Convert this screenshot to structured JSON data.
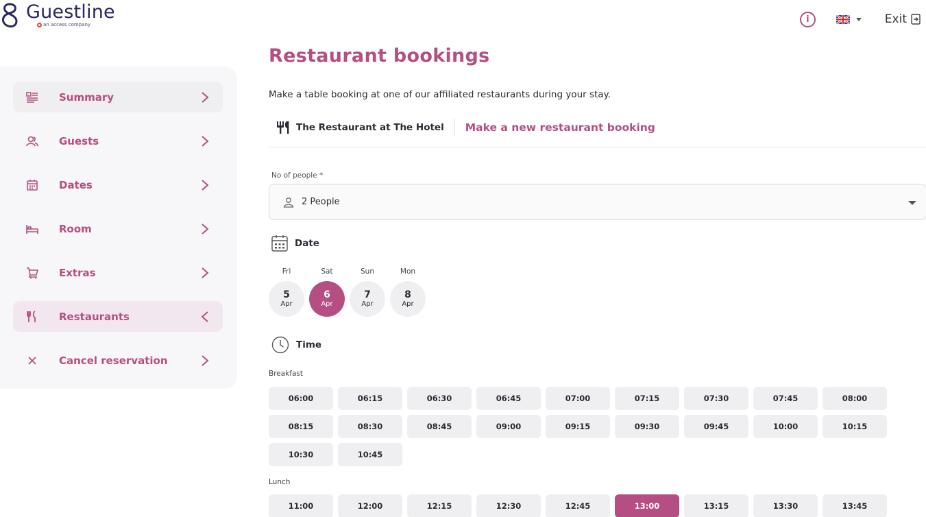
{
  "brand": {
    "name": "Guestline",
    "tagline": "an access company"
  },
  "topbar": {
    "info_icon": "info-icon",
    "language": "English (UK)",
    "exit_label": "Exit"
  },
  "sidebar": {
    "items": [
      {
        "label": "Summary",
        "icon": "summary-icon",
        "state": "grey",
        "chevron": "right"
      },
      {
        "label": "Guests",
        "icon": "guests-icon",
        "state": "none",
        "chevron": "right"
      },
      {
        "label": "Dates",
        "icon": "calendar-icon",
        "state": "none",
        "chevron": "right"
      },
      {
        "label": "Room",
        "icon": "bed-icon",
        "state": "none",
        "chevron": "right"
      },
      {
        "label": "Extras",
        "icon": "cart-icon",
        "state": "none",
        "chevron": "right"
      },
      {
        "label": "Restaurants",
        "icon": "cutlery-icon",
        "state": "active",
        "chevron": "left"
      },
      {
        "label": "Cancel reservation",
        "icon": "close-icon",
        "state": "none",
        "chevron": "right"
      }
    ]
  },
  "main": {
    "title": "Restaurant bookings",
    "intro": "Make a table booking at one of our affiliated restaurants during your stay.",
    "restaurant_name": "The Restaurant at The Hotel",
    "new_booking_label": "Make a new restaurant booking",
    "people_field": {
      "label": "No of people *",
      "value": "2 People"
    },
    "date_section": {
      "heading": "Date"
    },
    "days": [
      {
        "dow": "Fri",
        "day": "5",
        "month": "Apr",
        "selected": false
      },
      {
        "dow": "Sat",
        "day": "6",
        "month": "Apr",
        "selected": true
      },
      {
        "dow": "Sun",
        "day": "7",
        "month": "Apr",
        "selected": false
      },
      {
        "dow": "Mon",
        "day": "8",
        "month": "Apr",
        "selected": false
      }
    ],
    "time_section": {
      "heading": "Time"
    },
    "meals": [
      {
        "label": "Breakfast",
        "slots": [
          "06:00",
          "06:15",
          "06:30",
          "06:45",
          "07:00",
          "07:15",
          "07:30",
          "07:45",
          "08:00",
          "08:15",
          "08:30",
          "08:45",
          "09:00",
          "09:15",
          "09:30",
          "09:45",
          "10:00",
          "10:15",
          "10:30",
          "10:45"
        ],
        "selected": null
      },
      {
        "label": "Lunch",
        "slots": [
          "11:00",
          "12:00",
          "12:15",
          "12:30",
          "12:45",
          "13:00",
          "13:15",
          "13:30",
          "13:45"
        ],
        "selected": "13:00"
      }
    ]
  },
  "colors": {
    "accent": "#b54e82",
    "navy": "#2a2761",
    "chip": "#efeef1",
    "sidebar_bg": "#f7f6f8"
  }
}
